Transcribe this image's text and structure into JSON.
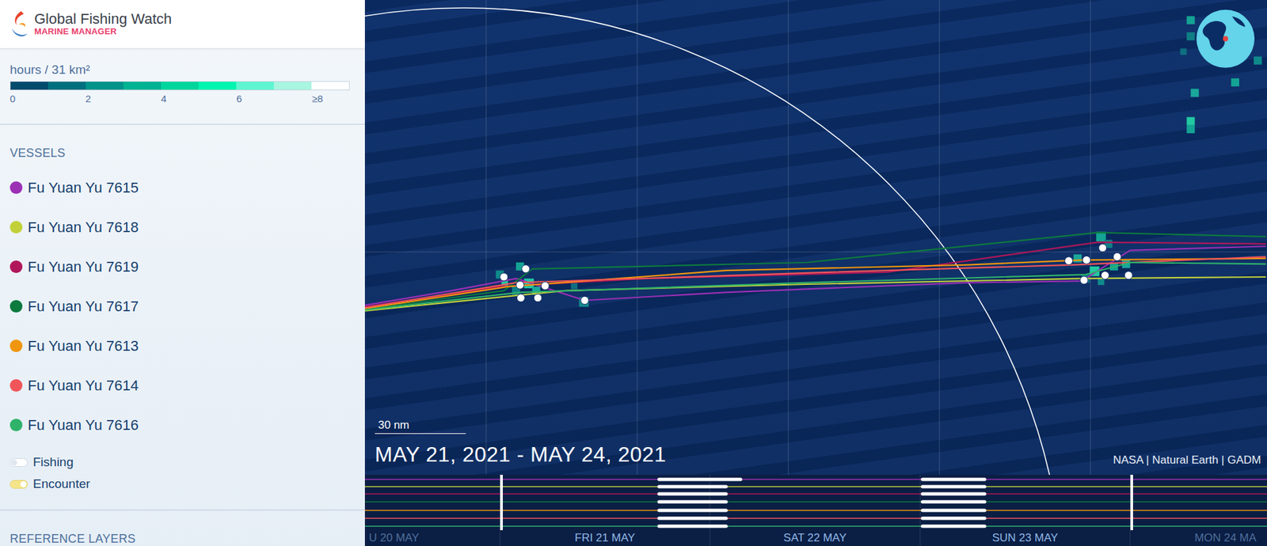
{
  "app": {
    "title": "Global Fishing Watch",
    "subtitle": "MARINE MANAGER"
  },
  "legend": {
    "unit": "hours / 31 km²",
    "ticks": [
      "0",
      "2",
      "4",
      "6",
      "≥8"
    ]
  },
  "vessels": {
    "heading": "VESSELS",
    "items": [
      {
        "name": "Fu Yuan Yu 7615",
        "color": "#9b30b5"
      },
      {
        "name": "Fu Yuan Yu 7618",
        "color": "#c2d13a"
      },
      {
        "name": "Fu Yuan Yu 7619",
        "color": "#b0175a"
      },
      {
        "name": "Fu Yuan Yu 7617",
        "color": "#0d7a3e"
      },
      {
        "name": "Fu Yuan Yu 7613",
        "color": "#f0960e"
      },
      {
        "name": "Fu Yuan Yu 7614",
        "color": "#f0555a"
      },
      {
        "name": "Fu Yuan Yu 7616",
        "color": "#2fb36a"
      }
    ]
  },
  "event_toggles": [
    {
      "label": "Fishing",
      "on": false
    },
    {
      "label": "Encounter",
      "on": true
    }
  ],
  "reference_layers": {
    "heading": "REFERENCE LAYERS"
  },
  "map": {
    "scale": "30 nm",
    "date_range": "MAY 21, 2021 - MAY 24, 2021",
    "attribution": "NASA | Natural Earth | GADM"
  },
  "timeline": {
    "days": [
      "U 20 MAY",
      "FRI 21 MAY",
      "SAT 22 MAY",
      "SUN 23 MAY",
      "MON 24 MA"
    ]
  }
}
